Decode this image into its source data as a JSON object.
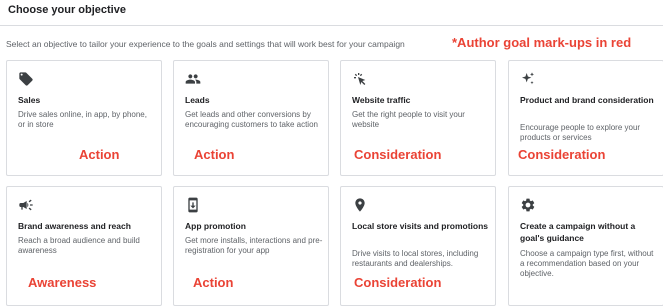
{
  "heading": "Choose your objective",
  "subtitle": "Select an objective to tailor your experience to the goals and settings that will work best for your campaign",
  "author_note": "*Author goal mark-ups in red",
  "colors": {
    "annotation": "#ea4335",
    "border": "#dadce0",
    "text": "#202124",
    "secondary": "#5f6368"
  },
  "cards": [
    {
      "icon": "tag-icon",
      "title": "Sales",
      "description": "Drive sales online, in app, by phone, or in store",
      "goal": "Action"
    },
    {
      "icon": "people-icon",
      "title": "Leads",
      "description": "Get leads and other conversions by encouraging customers to take action",
      "goal": "Action"
    },
    {
      "icon": "cursor-click-icon",
      "title": "Website traffic",
      "description": "Get the right people to visit your website",
      "goal": "Consideration"
    },
    {
      "icon": "sparkle-icon",
      "title": "Product and brand consideration",
      "description": "Encourage people to explore your products or services",
      "goal": "Consideration"
    },
    {
      "icon": "megaphone-icon",
      "title": "Brand awareness and reach",
      "description": "Reach a broad audience and build awareness",
      "goal": "Awareness"
    },
    {
      "icon": "phone-download-icon",
      "title": "App promotion",
      "description": "Get more installs, interactions and pre-registration for your app",
      "goal": "Action"
    },
    {
      "icon": "location-pin-icon",
      "title": "Local store visits and promotions",
      "description": "Drive visits to local stores, including restaurants and dealerships.",
      "goal": "Consideration"
    },
    {
      "icon": "gear-icon",
      "title": "Create a campaign without a goal's guidance",
      "description": "Choose a campaign type first, without a recommendation based on your objective.",
      "goal": ""
    }
  ]
}
